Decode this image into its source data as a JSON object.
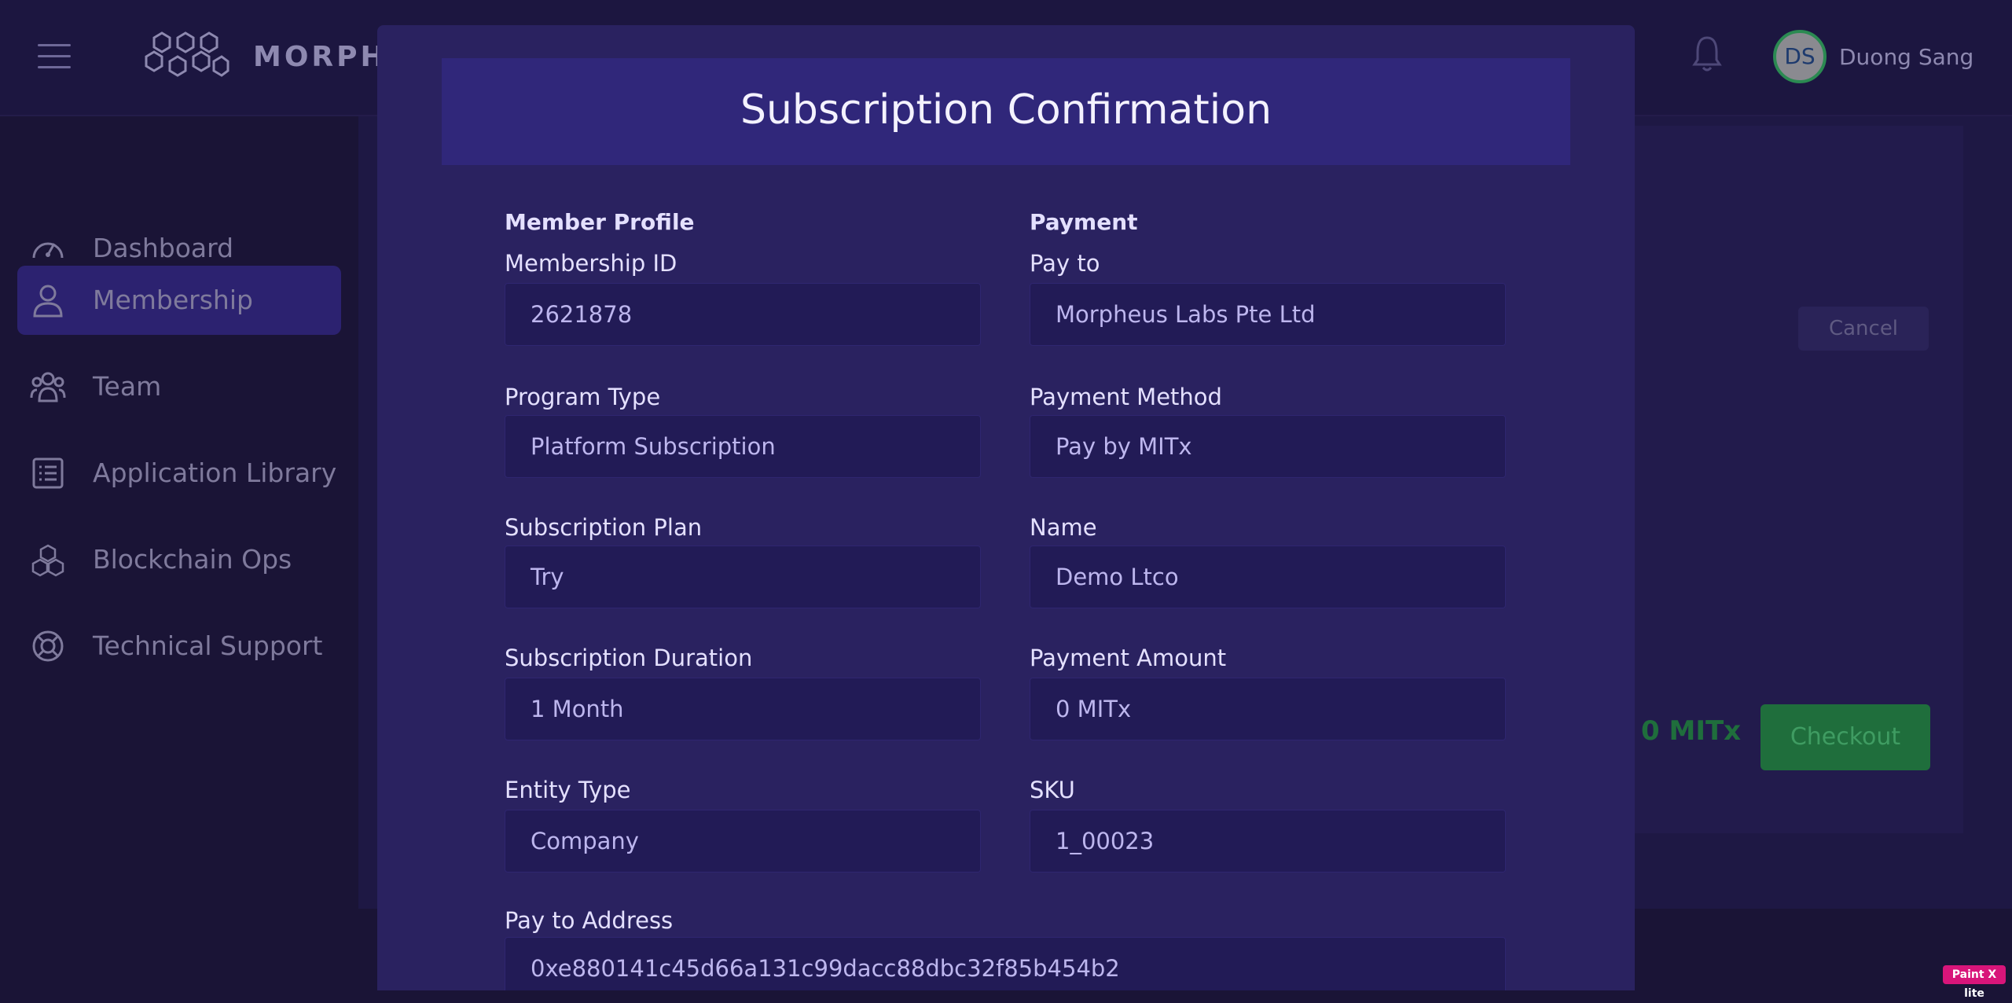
{
  "header": {
    "brand": "MORPHE",
    "user_initials": "DS",
    "user_name": "Duong Sang"
  },
  "sidebar": {
    "items": [
      {
        "label": "Dashboard",
        "icon": "dashboard-gauge-icon"
      },
      {
        "label": "Membership",
        "icon": "user-icon",
        "active": true
      },
      {
        "label": "Team",
        "icon": "team-icon"
      },
      {
        "label": "Application Library",
        "icon": "list-icon"
      },
      {
        "label": "Blockchain Ops",
        "icon": "cubes-icon"
      },
      {
        "label": "Technical Support",
        "icon": "lifebuoy-icon"
      }
    ]
  },
  "background": {
    "cancel_label": "Cancel",
    "amount": "0 MITx",
    "checkout_label": "Checkout"
  },
  "modal": {
    "title": "Subscription Confirmation",
    "member_section": "Member Profile",
    "payment_section": "Payment",
    "fields": {
      "membership_id": {
        "label": "Membership ID",
        "value": "2621878"
      },
      "program_type": {
        "label": "Program Type",
        "value": "Platform Subscription"
      },
      "subscription_plan": {
        "label": "Subscription Plan",
        "value": "Try"
      },
      "subscription_duration": {
        "label": "Subscription Duration",
        "value": "1 Month"
      },
      "entity_type": {
        "label": "Entity Type",
        "value": "Company"
      },
      "pay_to": {
        "label": "Pay to",
        "value": "Morpheus Labs Pte Ltd"
      },
      "payment_method": {
        "label": "Payment Method",
        "value": "Pay by MITx"
      },
      "name": {
        "label": "Name",
        "value": "Demo Ltco"
      },
      "payment_amount": {
        "label": "Payment Amount",
        "value": "0 MITx"
      },
      "sku": {
        "label": "SKU",
        "value": "1_00023"
      },
      "pay_to_address": {
        "label": "Pay to Address",
        "value": "0xe880141c45d66a131c99dacc88dbc32f85b454b2"
      }
    }
  },
  "watermark": "Paint X lite",
  "colors": {
    "modal_bg": "#2a2260",
    "modal_header": "#30277a",
    "input_bg": "#221b56",
    "active_nav": "#2c2270",
    "checkout_green": "#1f6e3c"
  }
}
